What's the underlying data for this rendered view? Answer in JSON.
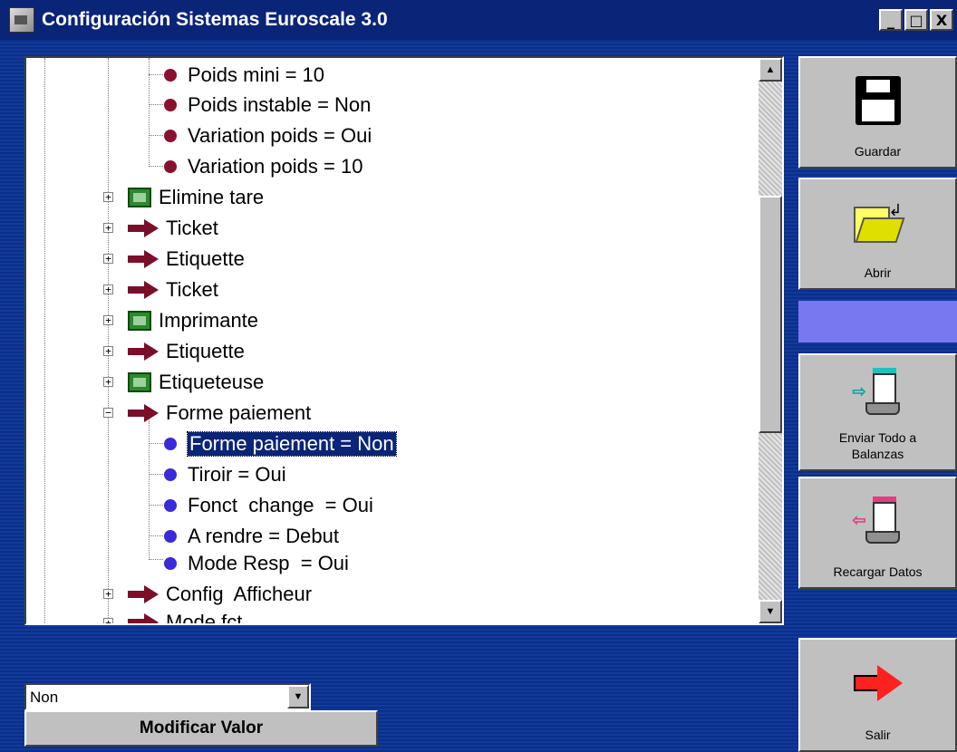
{
  "window": {
    "title": "Configuración Sistemas Euroscale 3.0",
    "controls": {
      "minimize": "_",
      "maximize": "□",
      "close": "X"
    }
  },
  "tree": {
    "items": [
      {
        "label": "Poids mini = 10",
        "icon": "red-dot"
      },
      {
        "label": "Poids instable = Non",
        "icon": "red-dot"
      },
      {
        "label": "Variation poids = Oui",
        "icon": "red-dot"
      },
      {
        "label": "Variation poids = 10",
        "icon": "red-dot"
      },
      {
        "label": "Elimine tare",
        "icon": "board"
      },
      {
        "label": "Ticket",
        "icon": "arrow"
      },
      {
        "label": "Etiquette",
        "icon": "arrow"
      },
      {
        "label": "Ticket",
        "icon": "arrow"
      },
      {
        "label": "Imprimante",
        "icon": "board"
      },
      {
        "label": "Etiquette",
        "icon": "arrow"
      },
      {
        "label": "Etiqueteuse",
        "icon": "board"
      },
      {
        "label": "Forme paiement",
        "icon": "arrow"
      },
      {
        "label": "Forme paiement = Non",
        "icon": "blue-dot",
        "selected": true
      },
      {
        "label": "Tiroir = Oui",
        "icon": "blue-dot"
      },
      {
        "label": "Fonct  change  = Oui",
        "icon": "blue-dot"
      },
      {
        "label": "A rendre = Debut",
        "icon": "blue-dot"
      },
      {
        "label": "Mode Resp  = Oui",
        "icon": "blue-dot"
      },
      {
        "label": "Config  Afficheur",
        "icon": "arrow"
      },
      {
        "label": "Mode fct",
        "icon": "arrow"
      }
    ]
  },
  "toolbar": {
    "save_label": "Guardar",
    "open_label": "Abrir",
    "send_label_1": "Enviar Todo a",
    "send_label_2": "Balanzas",
    "reload_label": "Recargar Datos",
    "exit_label": "Salir"
  },
  "editor": {
    "value": "Non",
    "modify_label": "Modificar Valor"
  },
  "colors": {
    "titlebar": "#0a2478",
    "background": "#0a2f8a",
    "selection": "#0a2478",
    "accent_panel": "#7878f0",
    "dot_red": "#8a1030",
    "dot_blue": "#3a2ad8"
  }
}
